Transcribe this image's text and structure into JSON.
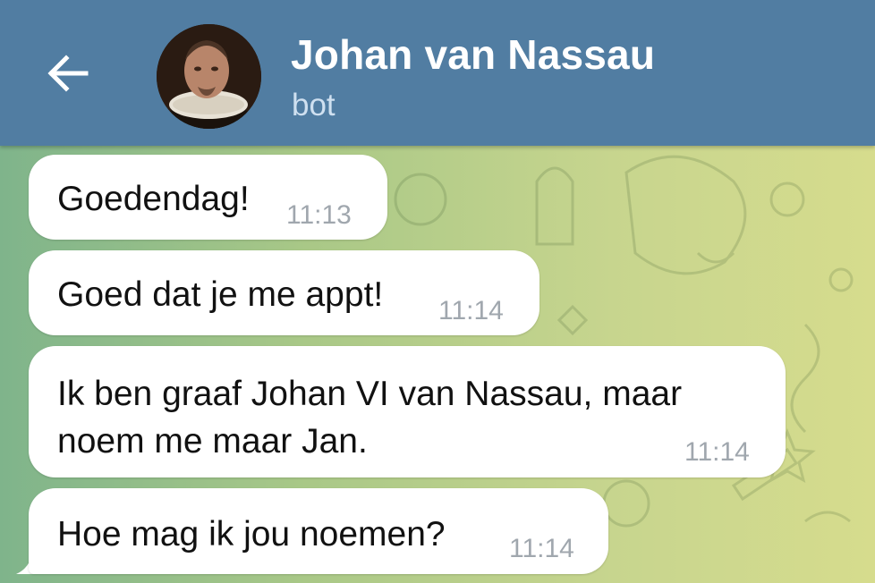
{
  "header": {
    "title": "Johan van Nassau",
    "subtitle": "bot"
  },
  "icons": {
    "back": "arrow-left-icon",
    "avatar": "portrait-avatar"
  },
  "colors": {
    "header_bg": "#517da2",
    "bubble_bg": "#ffffff",
    "time_text": "#a0a7ae"
  },
  "messages": [
    {
      "text": "Goedendag!",
      "time": "11:13"
    },
    {
      "text": "Goed dat je me appt!",
      "time": "11:14"
    },
    {
      "lines": [
        "Ik ben graaf Johan VI van Nassau, maar",
        "noem me maar Jan."
      ],
      "time": "11:14"
    },
    {
      "text": "Hoe mag ik jou noemen?",
      "time": "11:14"
    }
  ]
}
